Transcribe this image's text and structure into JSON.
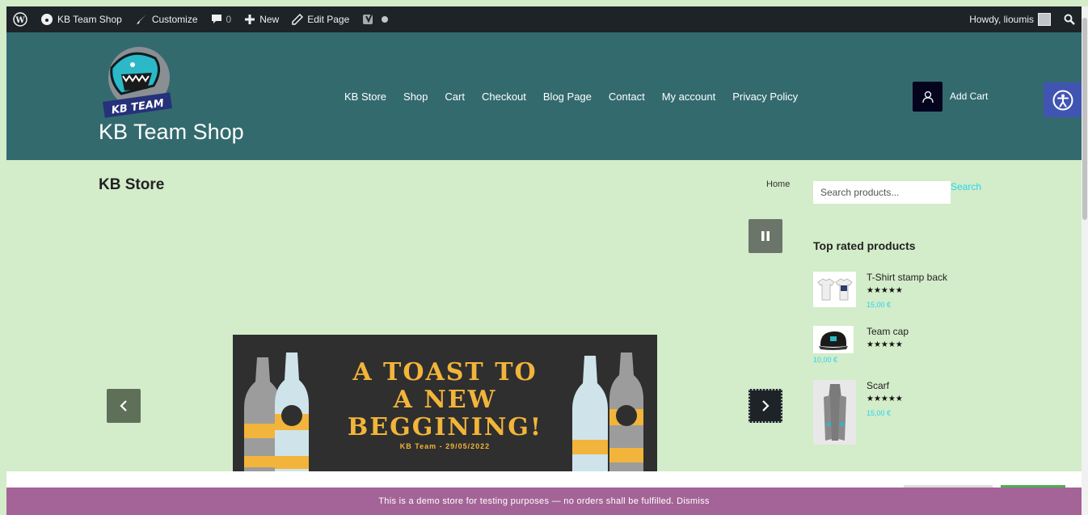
{
  "adminbar": {
    "site_name": "KB Team Shop",
    "customize": "Customize",
    "comments_count": "0",
    "new": "New",
    "edit_page": "Edit Page",
    "greeting": "Howdy, lioumis"
  },
  "header": {
    "logo_text": "KB TEAM",
    "site_title": "KB Team Shop",
    "nav": [
      "KB Store",
      "Shop",
      "Cart",
      "Checkout",
      "Blog Page",
      "Contact",
      "My account",
      "Privacy Policy"
    ],
    "add_cart": "Add Cart"
  },
  "main": {
    "page_title": "KB Store",
    "breadcrumb": "Home"
  },
  "slider": {
    "banner_line1": "A TOAST TO",
    "banner_line2": "A NEW",
    "banner_line3": "BEGGINING!",
    "banner_sub": "KB Team - 29/05/2022"
  },
  "sidebar": {
    "search_placeholder": "Search products...",
    "search_button": "Search",
    "widget_title": "Top rated products",
    "products": [
      {
        "name": "T-Shirt stamp back",
        "rating": "★★★★★",
        "price": "15,00 €"
      },
      {
        "name": "Team cap",
        "rating": "★★★★★",
        "price": "10,00 €"
      },
      {
        "name": "Scarf",
        "rating": "★★★★★",
        "price": "15,00 €"
      }
    ]
  },
  "footer": {
    "demo_notice": "This is a demo store for testing purposes — no orders shall be fulfilled. Dismiss"
  },
  "colors": {
    "header_bg": "#336a6e",
    "page_bg": "#d3ecc9",
    "demo_bar": "#a46497",
    "accent": "#28d4f0"
  }
}
